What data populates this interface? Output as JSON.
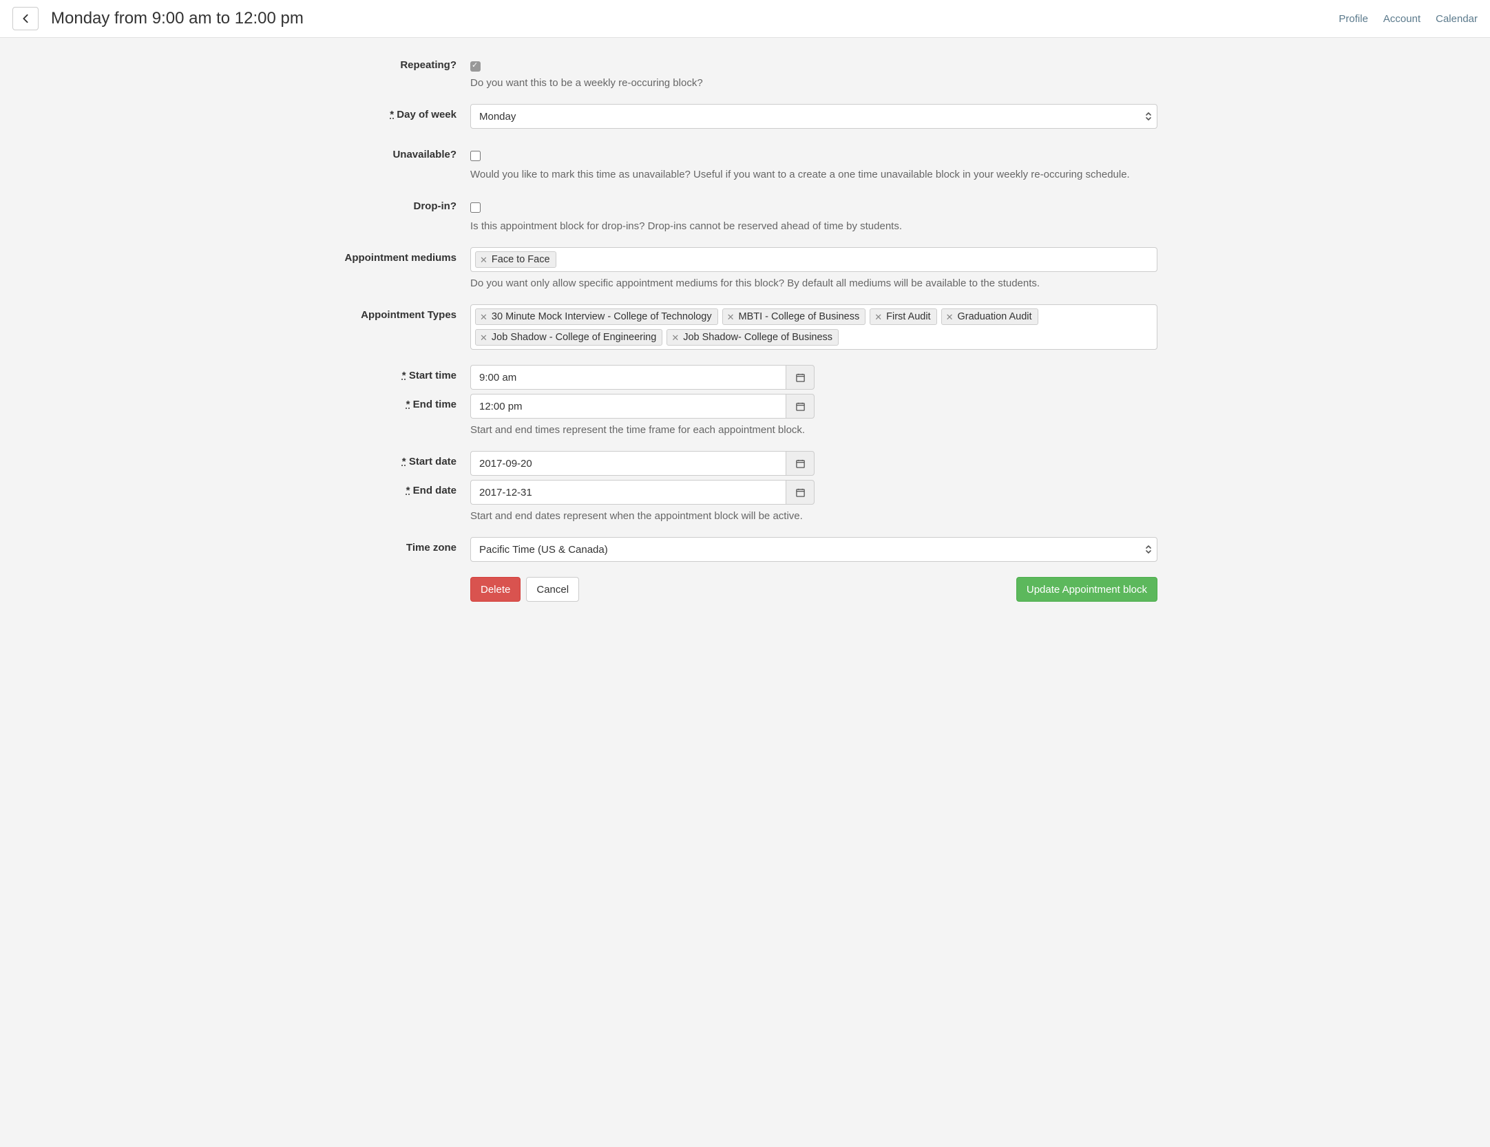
{
  "header": {
    "title": "Monday from 9:00 am to 12:00 pm",
    "nav": {
      "profile": "Profile",
      "account": "Account",
      "calendar": "Calendar"
    }
  },
  "labels": {
    "repeating": "Repeating?",
    "day_of_week": "Day of week",
    "unavailable": "Unavailable?",
    "drop_in": "Drop-in?",
    "appt_mediums": "Appointment mediums",
    "appt_types": "Appointment Types",
    "start_time": "Start time",
    "end_time": "End time",
    "start_date": "Start date",
    "end_date": "End date",
    "time_zone": "Time zone"
  },
  "help": {
    "repeating": "Do you want this to be a weekly re-occuring block?",
    "unavailable": "Would you like to mark this time as unavailable? Useful if you want to a create a one time unavailable block in your weekly re-occuring schedule.",
    "drop_in": "Is this appointment block for drop-ins? Drop-ins cannot be reserved ahead of time by students.",
    "mediums": "Do you want only allow specific appointment mediums for this block? By default all mediums will be available to the students.",
    "times": "Start and end times represent the time frame for each appointment block.",
    "dates": "Start and end dates represent when the appointment block will be active."
  },
  "values": {
    "repeating": true,
    "unavailable": false,
    "drop_in": false,
    "day_of_week": "Monday",
    "start_time": "9:00 am",
    "end_time": "12:00 pm",
    "start_date": "2017-09-20",
    "end_date": "2017-12-31",
    "time_zone": "Pacific Time (US & Canada)"
  },
  "mediums": [
    "Face to Face"
  ],
  "appointment_types": [
    "30 Minute Mock Interview - College of Technology",
    "MBTI - College of Business",
    "First Audit",
    "Graduation Audit",
    "Job Shadow - College of Engineering",
    "Job Shadow- College of Business"
  ],
  "buttons": {
    "delete": "Delete",
    "cancel": "Cancel",
    "update": "Update Appointment block"
  }
}
